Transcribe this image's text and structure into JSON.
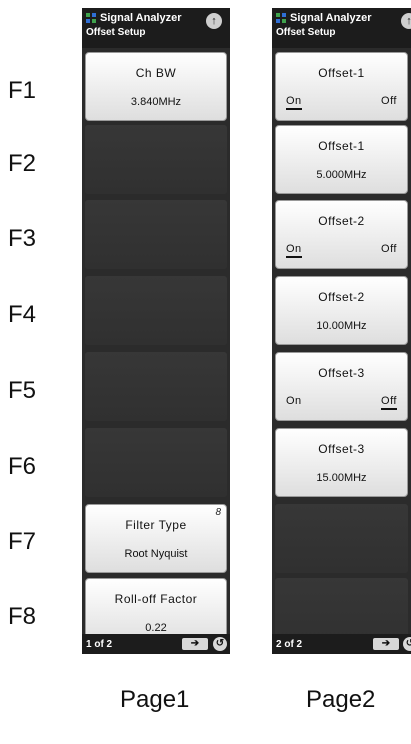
{
  "fkeys": [
    "F1",
    "F2",
    "F3",
    "F4",
    "F5",
    "F6",
    "F7",
    "F8"
  ],
  "panel1": {
    "app_title": "Signal Analyzer",
    "subtitle": "Offset Setup",
    "keys": [
      {
        "line1": "Ch BW",
        "line2": "3.840MHz"
      },
      {
        "line1": "Filter Type",
        "line2": "Root Nyquist",
        "mark": "8"
      },
      {
        "line1": "Roll-off Factor",
        "line2": "0.22"
      }
    ],
    "page_indicator": "1 of 2"
  },
  "panel2": {
    "app_title": "Signal Analyzer",
    "subtitle": "Offset Setup",
    "keys": [
      {
        "line1": "Offset-1",
        "on": "On",
        "off": "Off",
        "selected": "On"
      },
      {
        "line1": "Offset-1",
        "line2": "5.000MHz"
      },
      {
        "line1": "Offset-2",
        "on": "On",
        "off": "Off",
        "selected": "On"
      },
      {
        "line1": "Offset-2",
        "line2": "10.00MHz"
      },
      {
        "line1": "Offset-3",
        "on": "On",
        "off": "Off",
        "selected": "Off"
      },
      {
        "line1": "Offset-3",
        "line2": "15.00MHz"
      }
    ],
    "page_indicator": "2 of 2"
  },
  "icons": {
    "app": "grid-icon",
    "up": "up-arrow-icon",
    "next": "right-arrow-icon",
    "back": "return-icon"
  },
  "page_labels": [
    "Page1",
    "Page2"
  ]
}
